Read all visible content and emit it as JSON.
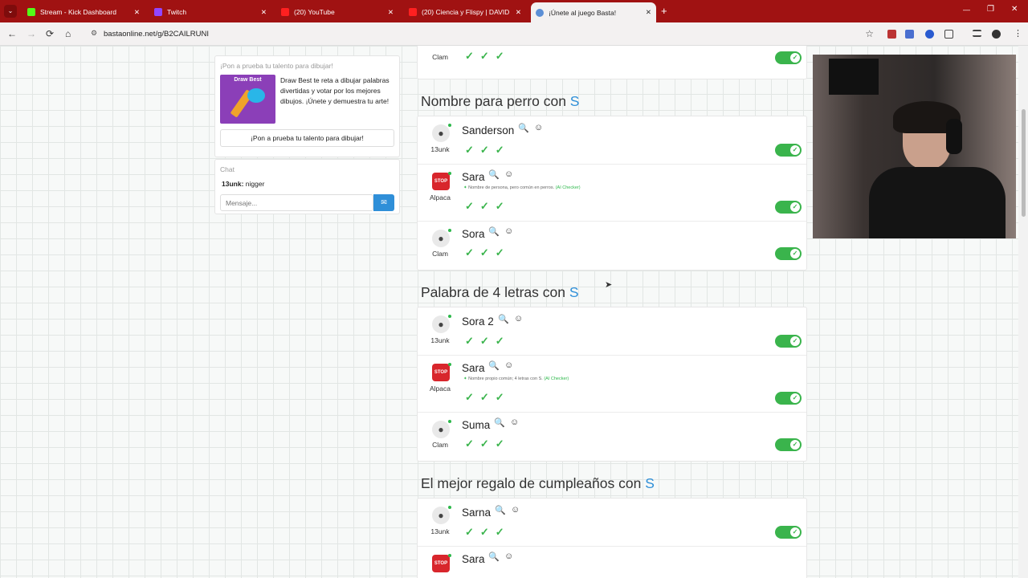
{
  "browser": {
    "tabs": [
      {
        "label": "Stream - Kick Dashboard",
        "icon": "kick-icon",
        "color": "#53fc18"
      },
      {
        "label": "Twitch",
        "icon": "twitch-icon",
        "color": "#9146ff"
      },
      {
        "label": "(20) YouTube",
        "icon": "youtube-icon",
        "color": "#ff0000"
      },
      {
        "label": "(20) Ciencia y Flispy | DAVID SU",
        "icon": "youtube-icon",
        "color": "#ff0000"
      },
      {
        "label": "¡Únete al juego Basta!",
        "icon": "globe-icon",
        "color": "#5b8fd6"
      }
    ],
    "close_glyph": "✕",
    "new_tab_glyph": "+",
    "url": "bastaonline.net/g/B2CAILRUNI",
    "nav": {
      "back": "←",
      "forward": "→",
      "reload": "⟳",
      "home": "⌂"
    },
    "window": {
      "minimize": "—",
      "restore": "❐",
      "close": "✕"
    }
  },
  "sidebar": {
    "promo": {
      "header": "¡Pon a prueba tu talento para dibujar!",
      "image_label": "Draw Best",
      "text": "Draw Best te reta a dibujar palabras divertidas y votar por los mejores dibujos. ¡Únete y demuestra tu arte!",
      "button": "¡Pon a prueba tu talento para dibujar!"
    },
    "chat": {
      "header": "Chat",
      "messages": [
        {
          "user": "13unk:",
          "text": "nigger"
        }
      ],
      "placeholder": "Mensaje..."
    }
  },
  "top_row": {
    "user": "Clam"
  },
  "sections": [
    {
      "title": "Nombre para perro con",
      "letter": "S",
      "rows": [
        {
          "user": "13unk",
          "word": "Sanderson",
          "avatar": "user",
          "note": null
        },
        {
          "user": "Alpaca",
          "word": "Sara",
          "avatar": "stop",
          "note": "Nombre de persona, pero común en perros.",
          "note_src": "(AI Checker)"
        },
        {
          "user": "Clam",
          "word": "Sora",
          "avatar": "user",
          "note": null
        }
      ]
    },
    {
      "title": "Palabra de 4 letras con",
      "letter": "S",
      "rows": [
        {
          "user": "13unk",
          "word": "Sora 2",
          "avatar": "user",
          "note": null
        },
        {
          "user": "Alpaca",
          "word": "Sara",
          "avatar": "stop",
          "note": "Nombre propio común; 4 letras con S.",
          "note_src": "(AI Checker)"
        },
        {
          "user": "Clam",
          "word": "Suma",
          "avatar": "user",
          "note": null
        }
      ]
    },
    {
      "title": "El mejor regalo de cumpleaños con",
      "letter": "S",
      "rows": [
        {
          "user": "13unk",
          "word": "Sarna",
          "avatar": "user",
          "note": null
        },
        {
          "user": "",
          "word": "Sara",
          "avatar": "stop",
          "note": null
        }
      ]
    }
  ],
  "stop_label": "STOP",
  "check_glyphs": "✓✓✓",
  "toggle_glyph": "✓"
}
